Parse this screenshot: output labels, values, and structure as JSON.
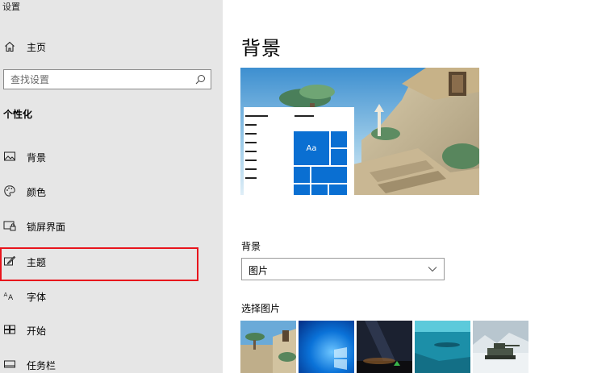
{
  "app": {
    "title": "设置"
  },
  "sidebar": {
    "home_label": "主页",
    "search_placeholder": "查找设置",
    "section_title": "个性化",
    "items": [
      {
        "label": "背景",
        "icon": "picture-icon"
      },
      {
        "label": "颜色",
        "icon": "palette-icon"
      },
      {
        "label": "锁屏界面",
        "icon": "lock-screen-icon"
      },
      {
        "label": "主题",
        "icon": "theme-icon",
        "highlighted": true
      },
      {
        "label": "字体",
        "icon": "font-icon"
      },
      {
        "label": "开始",
        "icon": "start-icon"
      },
      {
        "label": "任务栏",
        "icon": "taskbar-icon"
      }
    ],
    "highlight_color": "#e8141c"
  },
  "main": {
    "page_title": "背景",
    "preview": {
      "tile_text": "Aa",
      "accent": "#0a6fd2"
    },
    "background_label": "背景",
    "background_select": {
      "value": "图片"
    },
    "choose_picture_label": "选择图片",
    "thumbnails": [
      "beach-stairs",
      "windows-blue",
      "night-sky",
      "underwater",
      "snow-tank"
    ]
  }
}
